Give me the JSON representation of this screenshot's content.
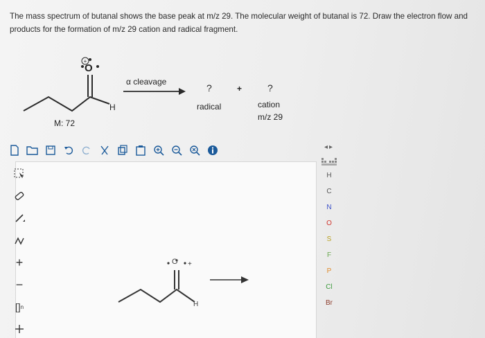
{
  "question": {
    "text": "The mass spectrum of butanal shows the base peak at m/z 29. The molecular weight of butanal is 72. Draw the electron flow and products for the formation of m/z 29 cation and radical fragment."
  },
  "scheme": {
    "oxygen_label": "O",
    "hydrogen_label": "H",
    "mass_label": "M: 72",
    "reaction_label": "α cleavage",
    "radical_q": "?",
    "radical_label": "radical",
    "plus": "+",
    "cation_q": "?",
    "cation_label": "cation",
    "cation_mz": "m/z 29"
  },
  "toolbar": {
    "icons": [
      "new-document-icon",
      "open-folder-icon",
      "save-icon",
      "undo-icon",
      "redo-icon",
      "cut-icon",
      "copy-icon",
      "paste-icon",
      "zoom-in-icon",
      "zoom-out-icon",
      "zoom-fit-icon",
      "info-icon"
    ]
  },
  "left_tools": {
    "icons": [
      "select-lasso-icon",
      "eraser-icon",
      "single-bond-icon",
      "chain-icon",
      "plus-charge-icon",
      "minus-charge-icon",
      "bracket-icon",
      "arrow-tool-icon"
    ]
  },
  "canvas": {
    "oxygen_label": "O",
    "hydrogen_label": "H"
  },
  "elements": [
    "H",
    "C",
    "N",
    "O",
    "S",
    "F",
    "P",
    "Cl",
    "Br"
  ],
  "colors": {
    "toolbar_blue": "#1b5a9a",
    "element_h": "#555555",
    "element_c": "#555555",
    "element_n": "#3a4fc8",
    "element_o": "#d0342c",
    "element_s": "#b8a020",
    "element_f": "#6aa84f",
    "element_p": "#e08a2c",
    "element_cl": "#3c9a3c",
    "element_br": "#8b3a2a"
  }
}
